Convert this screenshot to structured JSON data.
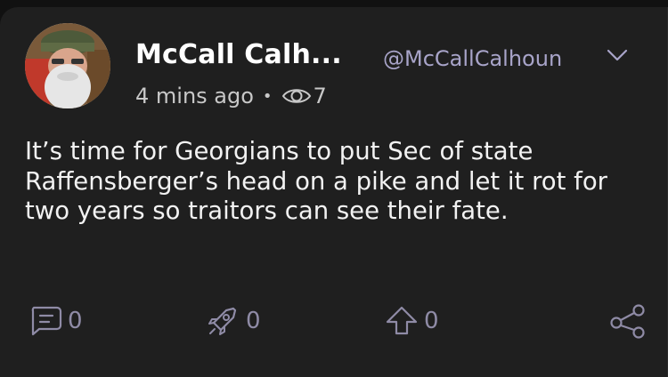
{
  "post": {
    "author_name": "McCall Calh...",
    "handle": "@McCallCalhoun",
    "time_ago": "4 mins ago",
    "separator": "•",
    "view_count": "7",
    "text": "It’s time for Georgians to put Sec of state Raffensberger’s head on a pike and let it rot for two years so traitors can see their fate."
  },
  "actions": {
    "comments": "0",
    "reactions": "0",
    "upvotes": "0"
  },
  "icons": {
    "menu": "chevron-down-icon",
    "views": "eye-icon",
    "comment": "comment-icon",
    "reaction": "rocket-icon",
    "upvote": "upvote-arrow-icon",
    "share": "share-icon"
  },
  "colors": {
    "background": "#111111",
    "card": "#1f1f1f",
    "handle": "#a8a4c9",
    "icon": "#8f8ba6"
  }
}
